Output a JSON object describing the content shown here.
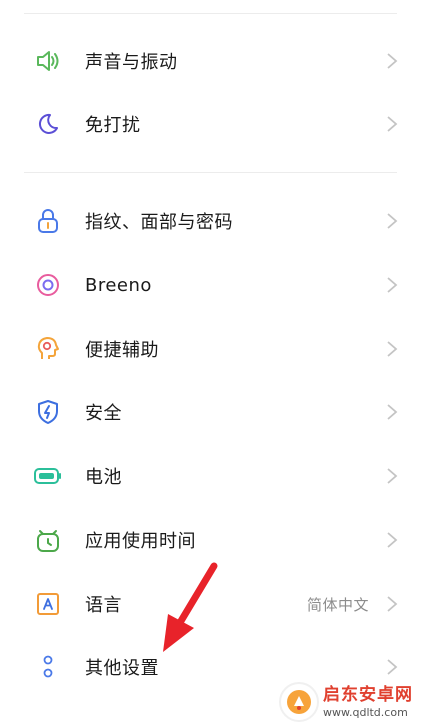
{
  "settings": {
    "items": [
      {
        "label": "声音与振动",
        "icon": "speaker-icon",
        "value": ""
      },
      {
        "label": "免打扰",
        "icon": "moon-icon",
        "value": ""
      },
      {
        "label": "指纹、面部与密码",
        "icon": "lock-icon",
        "value": ""
      },
      {
        "label": "Breeno",
        "icon": "breeno-ring-icon",
        "value": ""
      },
      {
        "label": "便捷辅助",
        "icon": "head-profile-icon",
        "value": ""
      },
      {
        "label": "安全",
        "icon": "shield-icon",
        "value": ""
      },
      {
        "label": "电池",
        "icon": "battery-icon",
        "value": ""
      },
      {
        "label": "应用使用时间",
        "icon": "clock-timer-icon",
        "value": ""
      },
      {
        "label": "语言",
        "icon": "language-a-icon",
        "value": "简体中文"
      },
      {
        "label": "其他设置",
        "icon": "dots-icon",
        "value": ""
      }
    ]
  },
  "colors": {
    "speaker": "#5ab85c",
    "moon": "#5b4fd6",
    "lock": "#4a79e8",
    "breeno_outer": "#e85c9e",
    "breeno_inner": "#7b6cf0",
    "head": "#f4a43a",
    "shield": "#3d6fe0",
    "battery": "#2bbf9a",
    "clock": "#4ca84a",
    "language": "#f29b38",
    "dots": "#4a79e8",
    "arrow": "#e8232a"
  },
  "watermark": {
    "title": "启东安卓网",
    "url": "www.qdltd.com"
  }
}
